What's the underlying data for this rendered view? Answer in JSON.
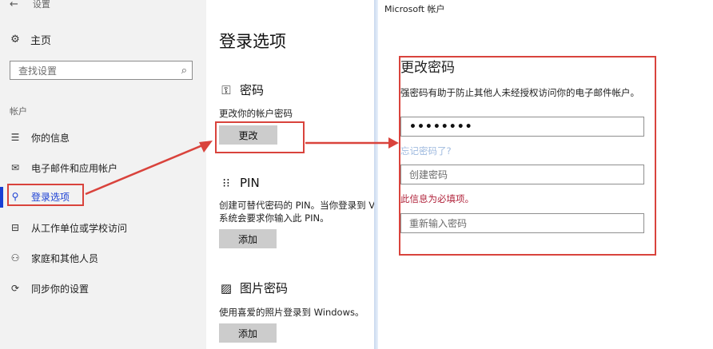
{
  "settings_window": {
    "title": "设置",
    "back_icon": "back-arrow-icon"
  },
  "nav": {
    "home_label": "主页",
    "search_placeholder": "查找设置",
    "section_label": "帐户",
    "items": [
      {
        "label": "你的信息",
        "icon": "person-card-icon"
      },
      {
        "label": "电子邮件和应用帐户",
        "icon": "mail-icon"
      },
      {
        "label": "登录选项",
        "icon": "key-icon",
        "active": true
      },
      {
        "label": "从工作单位或学校访问",
        "icon": "briefcase-icon"
      },
      {
        "label": "家庭和其他人员",
        "icon": "people-icon"
      },
      {
        "label": "同步你的设置",
        "icon": "sync-icon"
      }
    ]
  },
  "main": {
    "page_title": "登录选项",
    "password": {
      "heading": "密码",
      "description": "更改你的帐户密码",
      "button": "更改"
    },
    "pin": {
      "heading": "PIN",
      "description_line1": "创建可替代密码的 PIN。当你登录到 V",
      "description_line2": "系统会要求你输入此 PIN。",
      "button": "添加"
    },
    "picture_password": {
      "heading": "图片密码",
      "description": "使用喜爱的照片登录到 Windows。",
      "button": "添加"
    }
  },
  "dialog": {
    "title": "Microsoft 帐户",
    "heading": "更改密码",
    "description": "强密码有助于防止其他人未经授权访问你的电子邮件帐户。",
    "current_password_value": "••••••••",
    "forgot_link": "忘记密码了?",
    "new_password_placeholder": "创建密码",
    "error_message": "此信息为必填项。",
    "confirm_password_placeholder": "重新输入密码"
  },
  "colors": {
    "accent": "#1a3fd4",
    "annotation": "#d9433c",
    "error": "#b0223a",
    "link": "#9fbadf"
  }
}
